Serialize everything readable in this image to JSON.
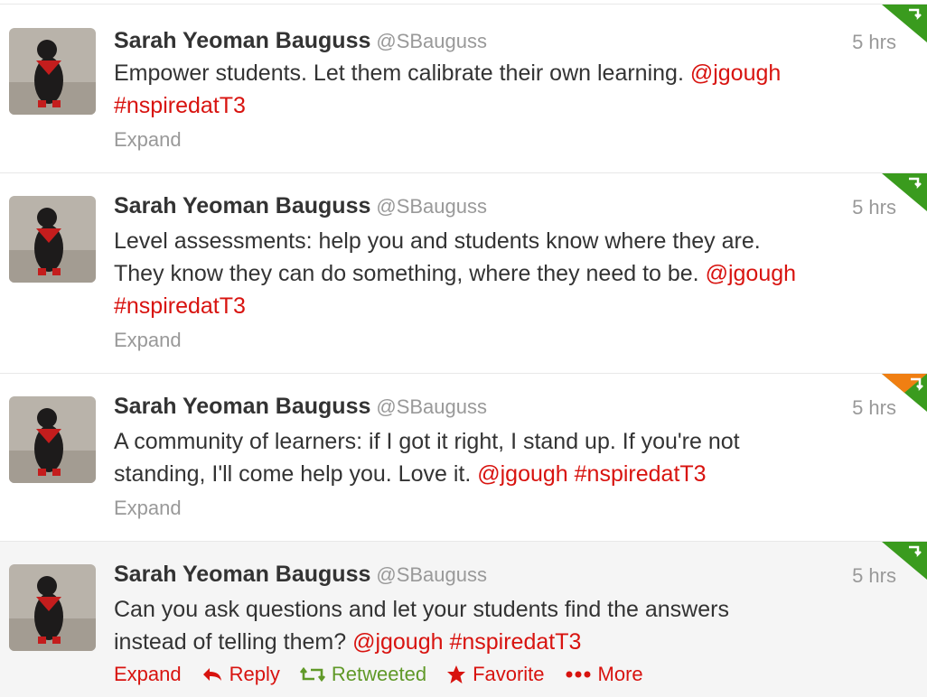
{
  "colors": {
    "link": "#d8130f",
    "muted": "#999999",
    "retweeted": "#609928",
    "corner_green": "#3a9b1e",
    "corner_orange": "#f07f12"
  },
  "tweets": [
    {
      "fullname": "Sarah Yeoman Bauguss",
      "username": "@SBauguss",
      "time": "5 hrs",
      "line1": "Empower students. Let them calibrate their own learning.",
      "mention": "@jgough",
      "hashtag": "#nspiredatT3",
      "expand": "Expand",
      "corner": "retweet-corner-icon"
    },
    {
      "fullname": "Sarah Yeoman Bauguss",
      "username": "@SBauguss",
      "time": "5 hrs",
      "line1": "Level assessments: help you and students know where they are.",
      "line2": "They know they can do something, where they need to be.",
      "mention": "@jgough",
      "hashtag": "#nspiredatT3",
      "expand": "Expand",
      "corner": "retweet-corner-icon"
    },
    {
      "fullname": "Sarah Yeoman Bauguss",
      "username": "@SBauguss",
      "time": "5 hrs",
      "line1": "A community of learners: if I got it right, I stand up. If you're not",
      "line2": "standing, I'll come help you. Love it.",
      "mention": "@jgough",
      "hashtag": "#nspiredatT3",
      "expand": "Expand",
      "corner": "favorite-retweet-corner-icon"
    },
    {
      "fullname": "Sarah Yeoman Bauguss",
      "username": "@SBauguss",
      "time": "5 hrs",
      "line1": "Can you ask questions and let your students find the answers",
      "line2": "instead of telling them?",
      "mention": "@jgough",
      "hashtag": "#nspiredatT3",
      "expand": "Expand",
      "actions": {
        "reply": "Reply",
        "retweeted": "Retweeted",
        "favorite": "Favorite",
        "more": "More"
      },
      "corner": "retweet-corner-icon"
    }
  ]
}
